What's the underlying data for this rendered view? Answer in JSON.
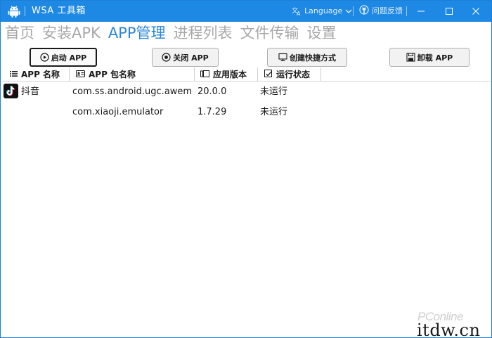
{
  "window": {
    "title": "WSA 工具箱",
    "language_label": "Language",
    "feedback_label": "问题反馈"
  },
  "nav": {
    "items": [
      {
        "label": "首页",
        "active": false
      },
      {
        "label": "安装APK",
        "active": false
      },
      {
        "label": "APP管理",
        "active": true
      },
      {
        "label": "进程列表",
        "active": false
      },
      {
        "label": "文件传输",
        "active": false
      },
      {
        "label": "设置",
        "active": false
      }
    ]
  },
  "toolbar": {
    "launch_label": "启动 APP",
    "close_label": "关闭 APP",
    "shortcut_label": "创建快捷方式",
    "uninstall_label": "卸载 APP"
  },
  "table": {
    "columns": {
      "name": "APP 名称",
      "package": "APP 包名称",
      "version": "应用版本",
      "status": "运行状态"
    },
    "rows": [
      {
        "name": "抖音",
        "package": "com.ss.android.ugc.aweme",
        "version": "20.0.0",
        "status": "未运行"
      },
      {
        "name": "",
        "package": "com.xiaoji.emulator",
        "version": "1.7.29",
        "status": "未运行"
      }
    ]
  },
  "watermark": {
    "brand": "PConline",
    "site": "itdw.cn"
  },
  "colors": {
    "titlebar": "#1e88e5",
    "nav_active": "#2b87d8",
    "nav_inactive": "#a8a8a8"
  },
  "icons": [
    "android-icon",
    "translate-icon",
    "chevron-down-icon",
    "github-icon",
    "minimize-icon",
    "maximize-icon",
    "close-icon",
    "play-icon",
    "stop-icon",
    "monitor-icon",
    "save-icon",
    "list-icon",
    "id-card-icon",
    "version-icon",
    "status-icon",
    "tiktok-icon"
  ]
}
